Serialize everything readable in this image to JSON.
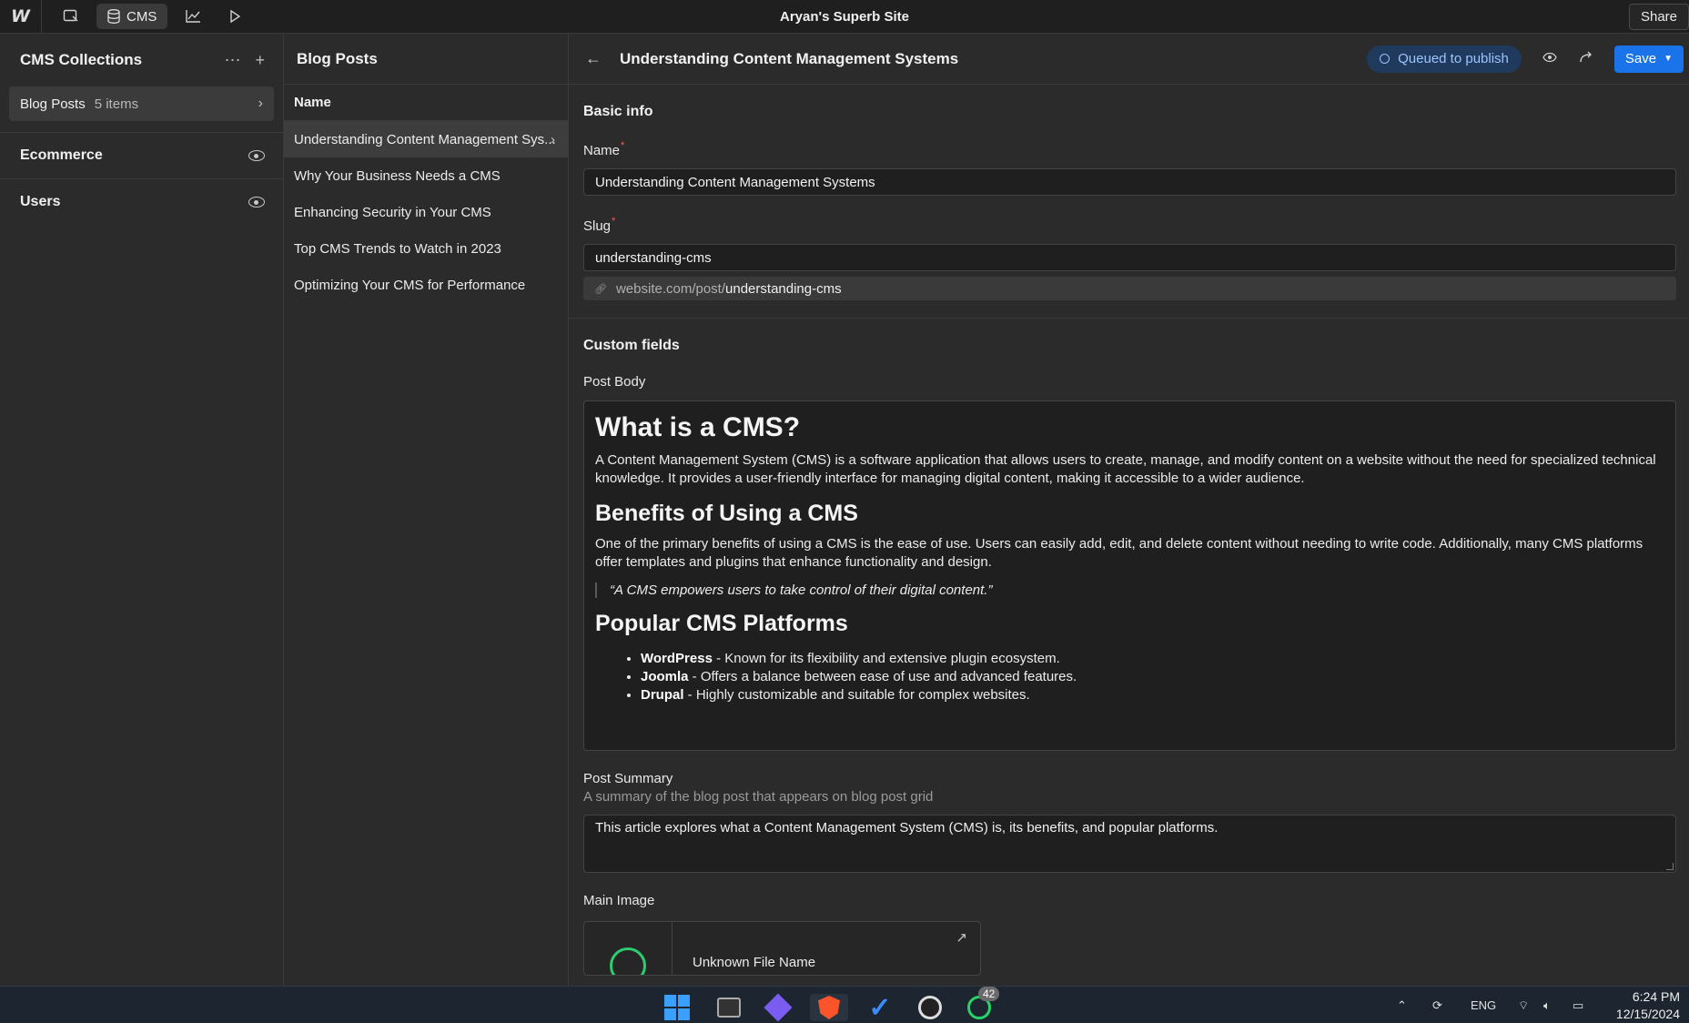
{
  "app": {
    "site_title": "Aryan's Superb Site",
    "share_label": "Share",
    "cms_tab_label": "CMS",
    "logo_text": "W"
  },
  "left_panel": {
    "title": "CMS Collections",
    "collections": [
      {
        "name": "Blog Posts",
        "count": "5 items"
      }
    ],
    "sections": [
      {
        "name": "Ecommerce"
      },
      {
        "name": "Users"
      }
    ]
  },
  "middle_panel": {
    "title": "Blog Posts",
    "column_header": "Name",
    "items": [
      "Understanding Content Management Sys...",
      "Why Your Business Needs a CMS",
      "Enhancing Security in Your CMS",
      "Top CMS Trends to Watch in 2023",
      "Optimizing Your CMS for Performance"
    ]
  },
  "editor": {
    "title": "Understanding Content Management Systems",
    "status": "Queued to publish",
    "save_label": "Save",
    "basic_info": {
      "heading": "Basic info",
      "name_label": "Name",
      "name_value": "Understanding Content Management Systems",
      "slug_label": "Slug",
      "slug_value": "understanding-cms",
      "url_base": "website.com/post/",
      "url_slug": "understanding-cms"
    },
    "custom_fields": {
      "heading": "Custom fields",
      "post_body_label": "Post Body",
      "post_body": {
        "h1": "What is a CMS?",
        "p1": "A Content Management System (CMS) is a software application that allows users to create, manage, and modify content on a website without the need for specialized technical knowledge. It provides a user-friendly interface for managing digital content, making it accessible to a wider audience.",
        "h2a": "Benefits of Using a CMS",
        "p2": "One of the primary benefits of using a CMS is the ease of use. Users can easily add, edit, and delete content without needing to write code. Additionally, many CMS platforms offer templates and plugins that enhance functionality and design.",
        "quote": "“A CMS empowers users to take control of their digital content.”",
        "h2b": "Popular CMS Platforms",
        "list": [
          {
            "name": "WordPress",
            "desc": " - Known for its flexibility and extensive plugin ecosystem."
          },
          {
            "name": "Joomla",
            "desc": " - Offers a balance between ease of use and advanced features."
          },
          {
            "name": "Drupal",
            "desc": " - Highly customizable and suitable for complex websites."
          }
        ]
      },
      "summary_label": "Post Summary",
      "summary_help": "A summary of the blog post that appears on blog post grid",
      "summary_value": "This article explores what a Content Management System (CMS) is, its benefits, and popular platforms.",
      "main_image_label": "Main Image",
      "main_image_file": "Unknown File Name"
    }
  },
  "taskbar": {
    "badge_count": "42",
    "lang": "ENG",
    "time": "6:24 PM",
    "date": "12/15/2024"
  },
  "colors": {
    "accent": "#1a73e8",
    "status_bg": "#1f3a5c",
    "status_text": "#9cc4ff",
    "required": "#ff5a4a"
  }
}
